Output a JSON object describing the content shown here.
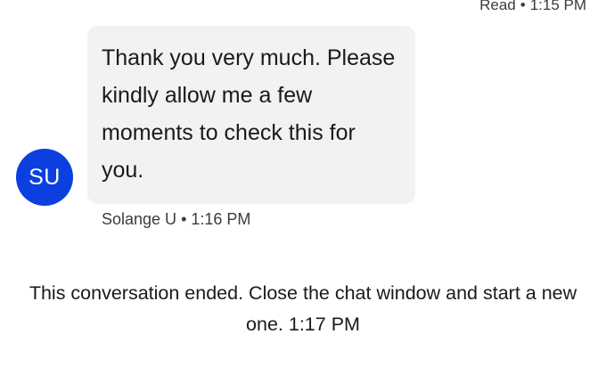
{
  "previous_message": {
    "status": "Read",
    "time": "1:15 PM"
  },
  "agent_message": {
    "avatar_initials": "SU",
    "avatar_color": "#0b3fe0",
    "text": "Thank you very much. Please kindly allow me a few moments to check this for you.",
    "sender": "Solange U",
    "time": "1:16 PM",
    "bubble_color": "#f2f2f2"
  },
  "system_message": {
    "text": "This conversation ended. Close the chat window and start a new one.",
    "time": "1:17 PM"
  }
}
